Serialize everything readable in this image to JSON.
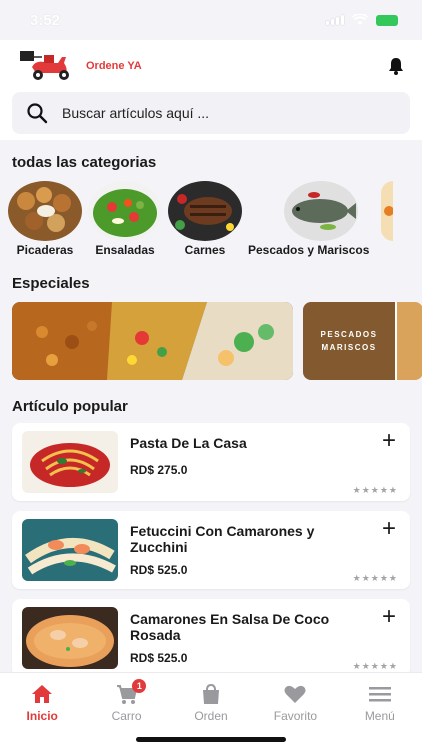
{
  "status": {
    "time": "3:52"
  },
  "header": {
    "brand": "Ordene YA"
  },
  "search": {
    "placeholder": "Buscar artículos aquí ..."
  },
  "categories": {
    "title": "todas las categorias",
    "items": [
      {
        "label": "Picaderas"
      },
      {
        "label": "Ensaladas"
      },
      {
        "label": "Carnes"
      },
      {
        "label": "Pescados y Mariscos"
      }
    ]
  },
  "specials": {
    "title": "Especiales",
    "banner_text": "PESCADOS MARISCOS"
  },
  "popular": {
    "title": "Artículo popular",
    "items": [
      {
        "name": "Pasta De La Casa",
        "price": "RD$ 275.0"
      },
      {
        "name": "Fetuccini Con Camarones y Zucchini",
        "price": "RD$ 525.0"
      },
      {
        "name": "Camarones En Salsa De Coco Rosada",
        "price": "RD$ 525.0"
      }
    ]
  },
  "tabbar": {
    "items": [
      {
        "label": "Inicio"
      },
      {
        "label": "Carro"
      },
      {
        "label": "Orden"
      },
      {
        "label": "Favorito"
      },
      {
        "label": "Menú"
      }
    ],
    "cart_badge": "1"
  },
  "colors": {
    "accent": "#e23a3a",
    "battery": "#34c759"
  }
}
